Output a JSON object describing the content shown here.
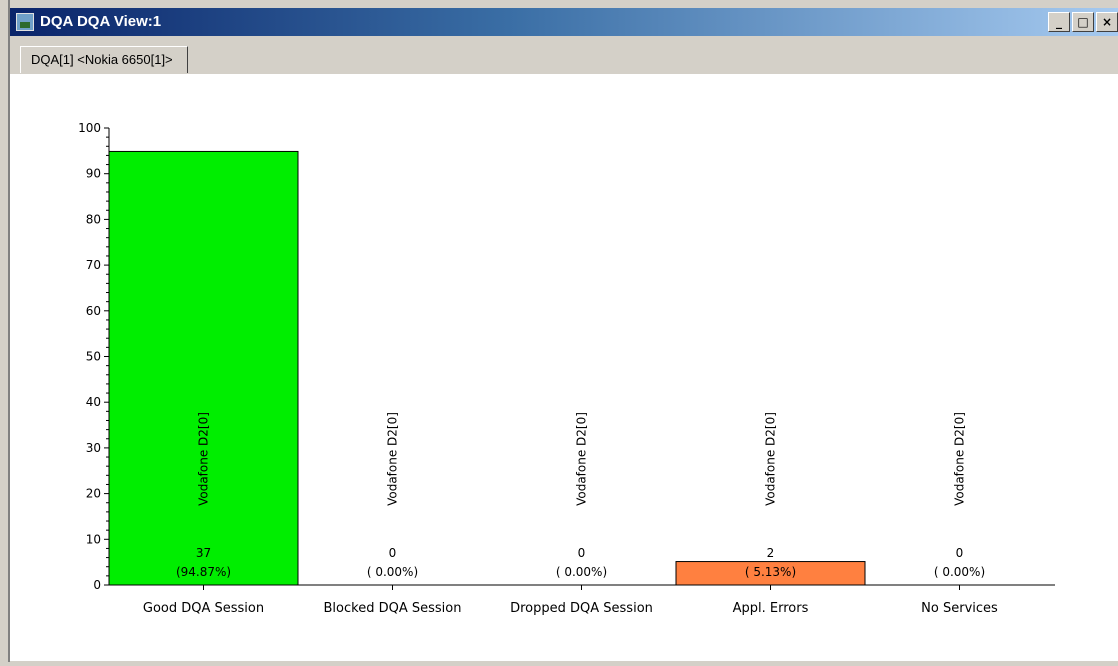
{
  "window": {
    "title": "DQA DQA View:1",
    "controls": {
      "minimize": "_",
      "maximize": "□",
      "close": "×"
    }
  },
  "tabs": [
    {
      "label": "DQA[1] <Nokia 6650[1]>"
    }
  ],
  "chart_data": {
    "type": "bar",
    "categories": [
      "Good DQA Session",
      "Blocked DQA Session",
      "Dropped DQA Session",
      "Appl. Errors",
      "No Services"
    ],
    "values": [
      94.87,
      0,
      0,
      5.13,
      0
    ],
    "counts": [
      "37",
      "0",
      "0",
      "2",
      "0"
    ],
    "percent_labels": [
      "(94.87%)",
      "( 0.00%)",
      "( 0.00%)",
      "( 5.13%)",
      "( 0.00%)"
    ],
    "series_labels": [
      "Vodafone D2[0]",
      "Vodafone D2[0]",
      "Vodafone D2[0]",
      "Vodafone D2[0]",
      "Vodafone D2[0]"
    ],
    "colors": [
      "#00ee00",
      "#ffffff",
      "#ffffff",
      "#ff8040",
      "#ffffff"
    ],
    "ylim": [
      0,
      100
    ],
    "yticks": [
      "0",
      "10",
      "20",
      "30",
      "40",
      "50",
      "60",
      "70",
      "80",
      "90",
      "100"
    ],
    "grid": false
  }
}
